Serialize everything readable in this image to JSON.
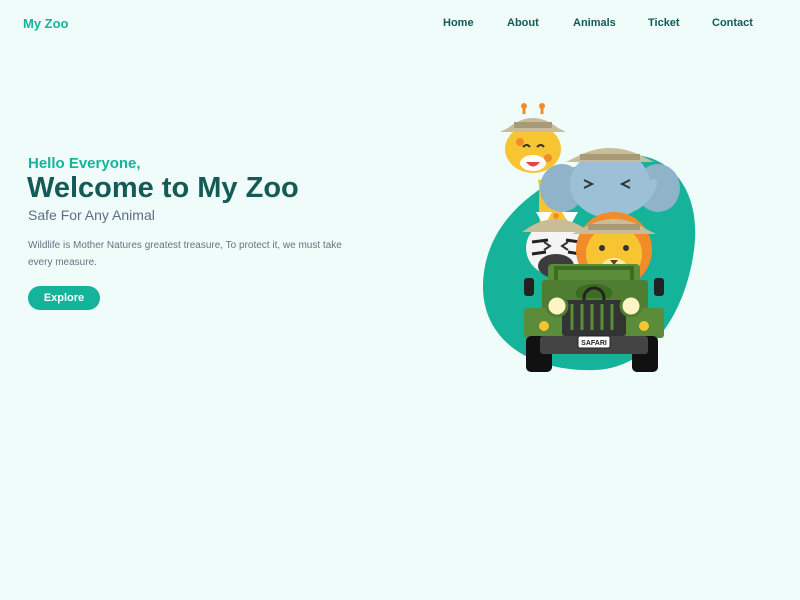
{
  "header": {
    "logo": "My Zoo",
    "nav": [
      {
        "label": "Home"
      },
      {
        "label": "About"
      },
      {
        "label": "Animals"
      },
      {
        "label": "Ticket"
      },
      {
        "label": "Contact"
      }
    ]
  },
  "hero": {
    "greeting": "Hello Everyone,",
    "title": "Welcome to My Zoo",
    "subtitle": "Safe For Any Animal",
    "description": "Wildlife is Mother Natures greatest treasure, To protect it, we must take every measure.",
    "button_label": "Explore",
    "illustration": {
      "plate_text": "SAFARI"
    }
  },
  "colors": {
    "background": "#effcf9",
    "accent": "#14b39a",
    "heading": "#145a56",
    "body_text": "#607482"
  }
}
